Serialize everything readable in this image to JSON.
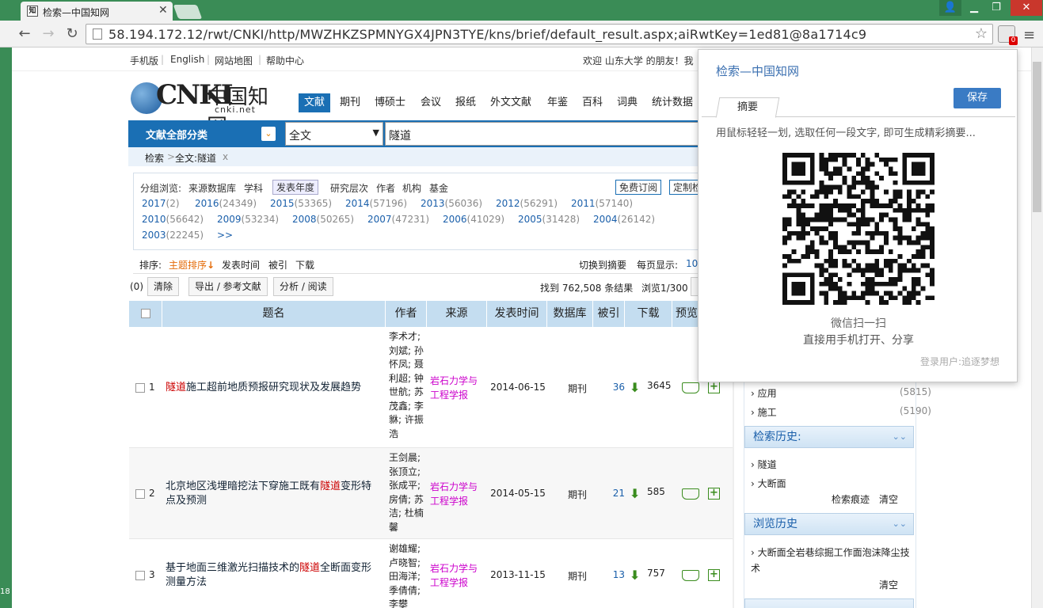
{
  "browser": {
    "tab_title": "检索—中国知网",
    "tab_favicon": "知",
    "url": "58.194.172.12/rwt/CNKI/http/MWZHKZSPMNYGX4JPN3TYE/kns/brief/default_result.aspx;aiRwtKey=1ed81@8a1714c9",
    "ext_badge": "0",
    "accent": "#3a8c56"
  },
  "topnav": {
    "mobile": "手机版",
    "english": "English",
    "sitemap": "网站地图",
    "help": "帮助中心",
    "welcome": "欢迎  山东大学 的朋友！我"
  },
  "logo": {
    "cnki": "CNKI",
    "cn": "中国知网",
    "dot": "cnki.net"
  },
  "categories": [
    "文献",
    "期刊",
    "博硕士",
    "会议",
    "报纸",
    "外文文献",
    "年鉴",
    "百科",
    "词典",
    "统计数据"
  ],
  "search": {
    "all_label": "文献全部分类",
    "field": "全文",
    "query": "隧道"
  },
  "crumb": {
    "root": "检索",
    "sep": ">",
    "term": "全文:隧道",
    "x": "x"
  },
  "group": {
    "label": "分组浏览:",
    "items": [
      "来源数据库",
      "学科",
      "发表年度",
      "研究层次",
      "作者",
      "机构",
      "基金"
    ],
    "free_sub": "免费订阅",
    "custom": "定制检"
  },
  "years": [
    {
      "y": "2017",
      "n": "(2)"
    },
    {
      "y": "2016",
      "n": "(24349)"
    },
    {
      "y": "2015",
      "n": "(53365)"
    },
    {
      "y": "2014",
      "n": "(57196)"
    },
    {
      "y": "2013",
      "n": "(56036)"
    },
    {
      "y": "2012",
      "n": "(56291)"
    },
    {
      "y": "2011",
      "n": "(57140)"
    },
    {
      "y": "2010",
      "n": "(56642)"
    },
    {
      "y": "2009",
      "n": "(53234)"
    },
    {
      "y": "2008",
      "n": "(50265)"
    },
    {
      "y": "2007",
      "n": "(47231)"
    },
    {
      "y": "2006",
      "n": "(41029)"
    },
    {
      "y": "2005",
      "n": "(31428)"
    },
    {
      "y": "2004",
      "n": "(26142)"
    },
    {
      "y": "2003",
      "n": "(22245)"
    },
    {
      "y": ">>",
      "n": ""
    }
  ],
  "sort": {
    "label": "排序:",
    "topic": "主题排序",
    "date": "发表时间",
    "cited": "被引",
    "download": "下载",
    "switch": "切换到摘要",
    "per_page": "每页显示:",
    "per_val": "10"
  },
  "actions": {
    "count": "(0)",
    "clear": "清除",
    "export": "导出 / 参考文献",
    "analyze": "分析 / 阅读",
    "found": "找到 762,508 条结果",
    "browse": "浏览1/300"
  },
  "table": {
    "headers": [
      "题名",
      "作者",
      "来源",
      "发表时间",
      "数据库",
      "被引",
      "下载",
      "预览"
    ],
    "rows": [
      {
        "num": "1",
        "hl": "隧道",
        "pre": "",
        "post": "施工超前地质预报研究现状及发展趋势",
        "authors": "李术才; 刘斌; 孙怀凤; 聂利超; 钟世航; 苏茂鑫; 李貅; 许振浩",
        "source": "岩石力学与工程学报",
        "date": "2014-06-15",
        "db": "期刊",
        "cited": "36",
        "downloads": "3645"
      },
      {
        "num": "2",
        "hl": "隧道",
        "pre": "北京地区浅埋暗挖法下穿施工既有",
        "post": "变形特点及预测",
        "authors": "王剑晨; 张顶立; 张成平; 房倩; 苏洁; 杜楠馨",
        "source": "岩石力学与工程学报",
        "date": "2014-05-15",
        "db": "期刊",
        "cited": "21",
        "downloads": "585"
      },
      {
        "num": "3",
        "hl": "隧道",
        "pre": "基于地面三维激光扫描技术的",
        "post": "全断面变形测量方法",
        "authors": "谢雄耀; 卢晓智; 田海洋; 季倩倩; 李攀",
        "source": "岩石力学与工程学报",
        "date": "2013-11-15",
        "db": "期刊",
        "cited": "13",
        "downloads": "757"
      }
    ]
  },
  "facets": {
    "items": [
      {
        "label": "应用",
        "n": "(5815)"
      },
      {
        "label": "施工",
        "n": "(5190)"
      }
    ],
    "history_title": "检索历史:",
    "history": [
      "隧道",
      "大断面"
    ],
    "trace": "检索痕迹",
    "clear": "清空",
    "browse_title": "浏览历史",
    "browse_item": "大断面全岩巷综掘工作面泡沫降尘技术",
    "browse_clear": "清空"
  },
  "popup": {
    "title": "检索—中国知网",
    "save": "保存",
    "tab": "摘要",
    "hint": "用鼠标轻轻一划, 选取任何一段文字, 即可生成精彩摘要...",
    "scan": "微信扫一扫",
    "share": "直接用手机打开、分享",
    "user": "登录用户:追逐梦想"
  },
  "desktop_clock": "18"
}
